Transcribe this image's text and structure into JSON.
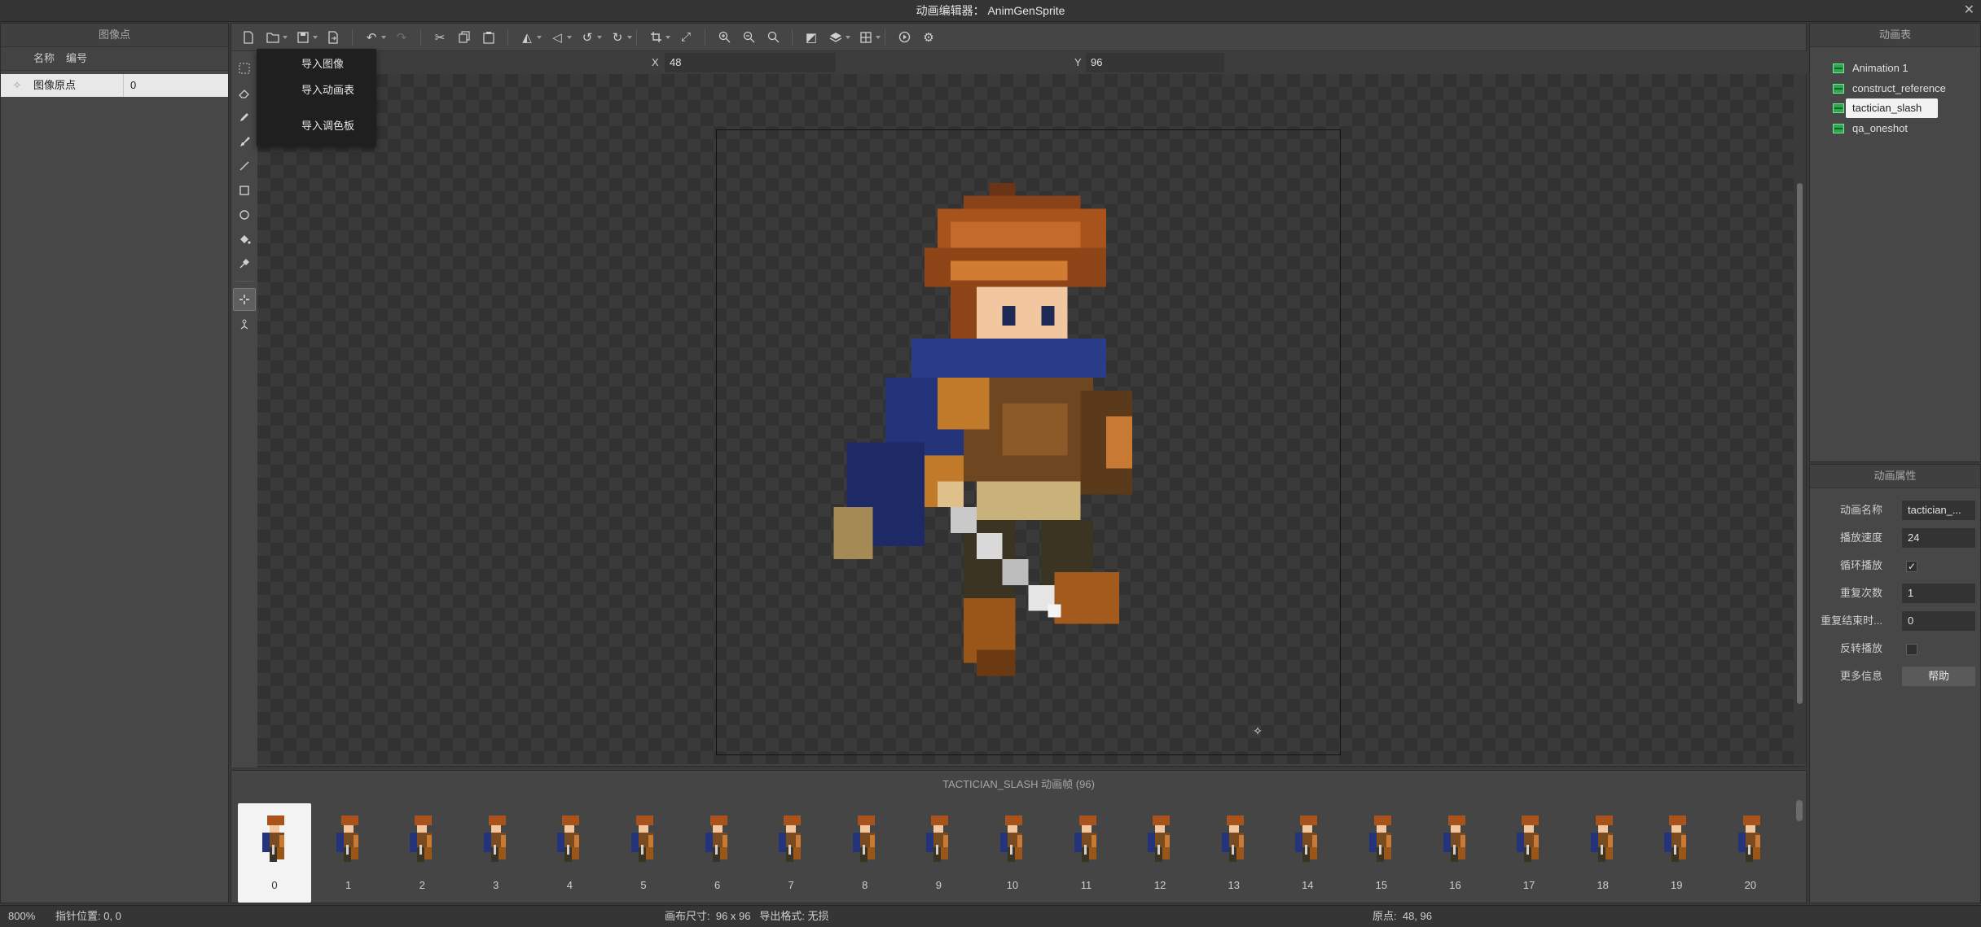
{
  "window": {
    "title": "动画编辑器： AnimGenSprite",
    "close_glyph": "✕"
  },
  "left_panel": {
    "title": "图像点",
    "columns": [
      "名称",
      "编号"
    ],
    "rows": [
      {
        "name": "图像原点",
        "id": "0"
      }
    ]
  },
  "coords": {
    "x_label": "X",
    "x_value": "48",
    "y_label": "Y",
    "y_value": "96"
  },
  "import_menu": {
    "items": [
      "导入图像",
      "导入动画表",
      "导入调色板"
    ]
  },
  "timeline": {
    "title": "TACTICIAN_SLASH 动画帧 (96)",
    "selected_frame": 0,
    "frames": [
      "0",
      "1",
      "2",
      "3",
      "4",
      "5",
      "6",
      "7",
      "8",
      "9",
      "10",
      "11",
      "12",
      "13",
      "14",
      "15",
      "16",
      "17",
      "18",
      "19",
      "20"
    ]
  },
  "animations_panel": {
    "title": "动画表",
    "items": [
      "Animation 1",
      "construct_reference",
      "tactician_slash",
      "qa_oneshot"
    ],
    "selected": "tactician_slash"
  },
  "properties_panel": {
    "title": "动画属性",
    "name_label": "动画名称",
    "name_value": "tactician_...",
    "speed_label": "播放速度",
    "speed_value": "24",
    "loop_label": "循环播放",
    "loop_checked": true,
    "loop_mark": "✓",
    "repeat_label": "重复次数",
    "repeat_value": "1",
    "repeat_end_label": "重复结束时...",
    "repeat_end_value": "0",
    "reverse_label": "反转播放",
    "reverse_checked": false,
    "more_label": "更多信息",
    "help_label": "帮助"
  },
  "status": {
    "zoom": "800%",
    "pointer": "指针位置: 0, 0",
    "canvas": "画布尺寸:  96 x 96   导出格式: 无损",
    "origin": "原点:  48, 96"
  },
  "colors": {
    "accent_green": "#2fa84f",
    "selected_bg": "#f2f2f2"
  }
}
